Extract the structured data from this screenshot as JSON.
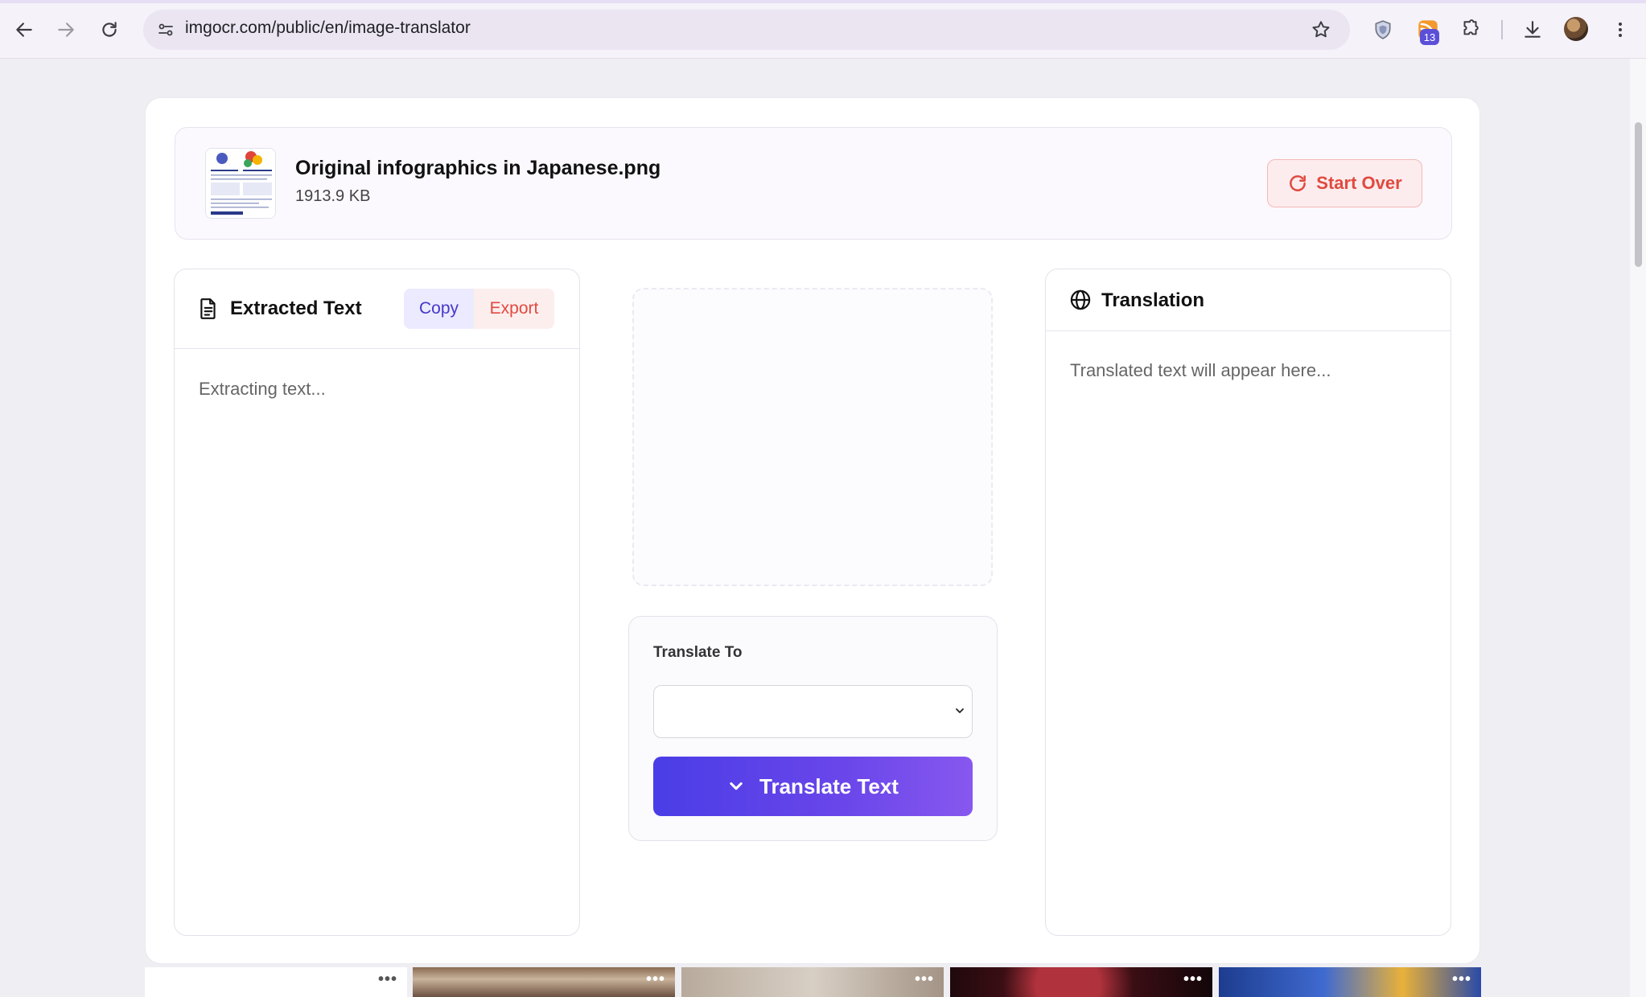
{
  "browser": {
    "url": "imgocr.com/public/en/image-translator",
    "extension_badge": "13"
  },
  "file": {
    "name": "Original infographics in Japanese.png",
    "size": "1913.9 KB",
    "start_over_label": "Start Over"
  },
  "extracted": {
    "title": "Extracted Text",
    "copy_label": "Copy",
    "export_label": "Export",
    "status": "Extracting text..."
  },
  "translate": {
    "label": "Translate To",
    "selected_language": "",
    "button_label": "Translate Text"
  },
  "translation": {
    "title": "Translation",
    "placeholder": "Translated text will appear here..."
  },
  "bottom_tiles": {
    "more_label": "•••"
  },
  "colors": {
    "accent": "#4f46e5",
    "danger": "#e04a3f"
  }
}
